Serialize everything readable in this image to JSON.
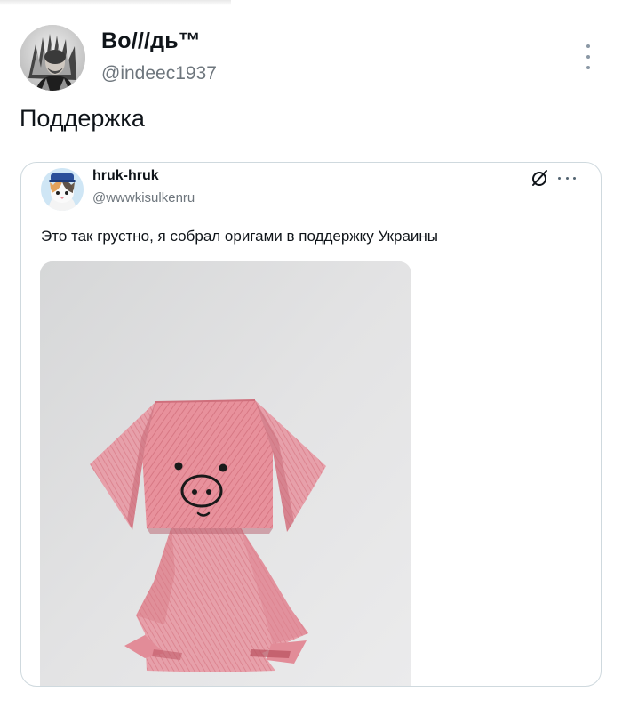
{
  "post": {
    "display_name": "Во///дь™",
    "handle": "@indeec1937",
    "text": "Поддержка",
    "avatar_icon": "avatar-portrait-icon",
    "more_icon": "more-vertical-icon"
  },
  "quoted_post": {
    "display_name": "hruk-hruk",
    "handle": "@wwwkisulkenru",
    "text": "Это так грустно, я собрал оригами в поддержку Украины",
    "avatar_icon": "avatar-cat-icon",
    "grok_icon": "grok-icon",
    "more_icon": "more-horizontal-icon",
    "media_icon": "origami-pig-image"
  },
  "colors": {
    "text_primary": "#0f1419",
    "text_secondary": "#6e767d",
    "border": "#cfd9de",
    "pig_pink": "#e48a97"
  }
}
